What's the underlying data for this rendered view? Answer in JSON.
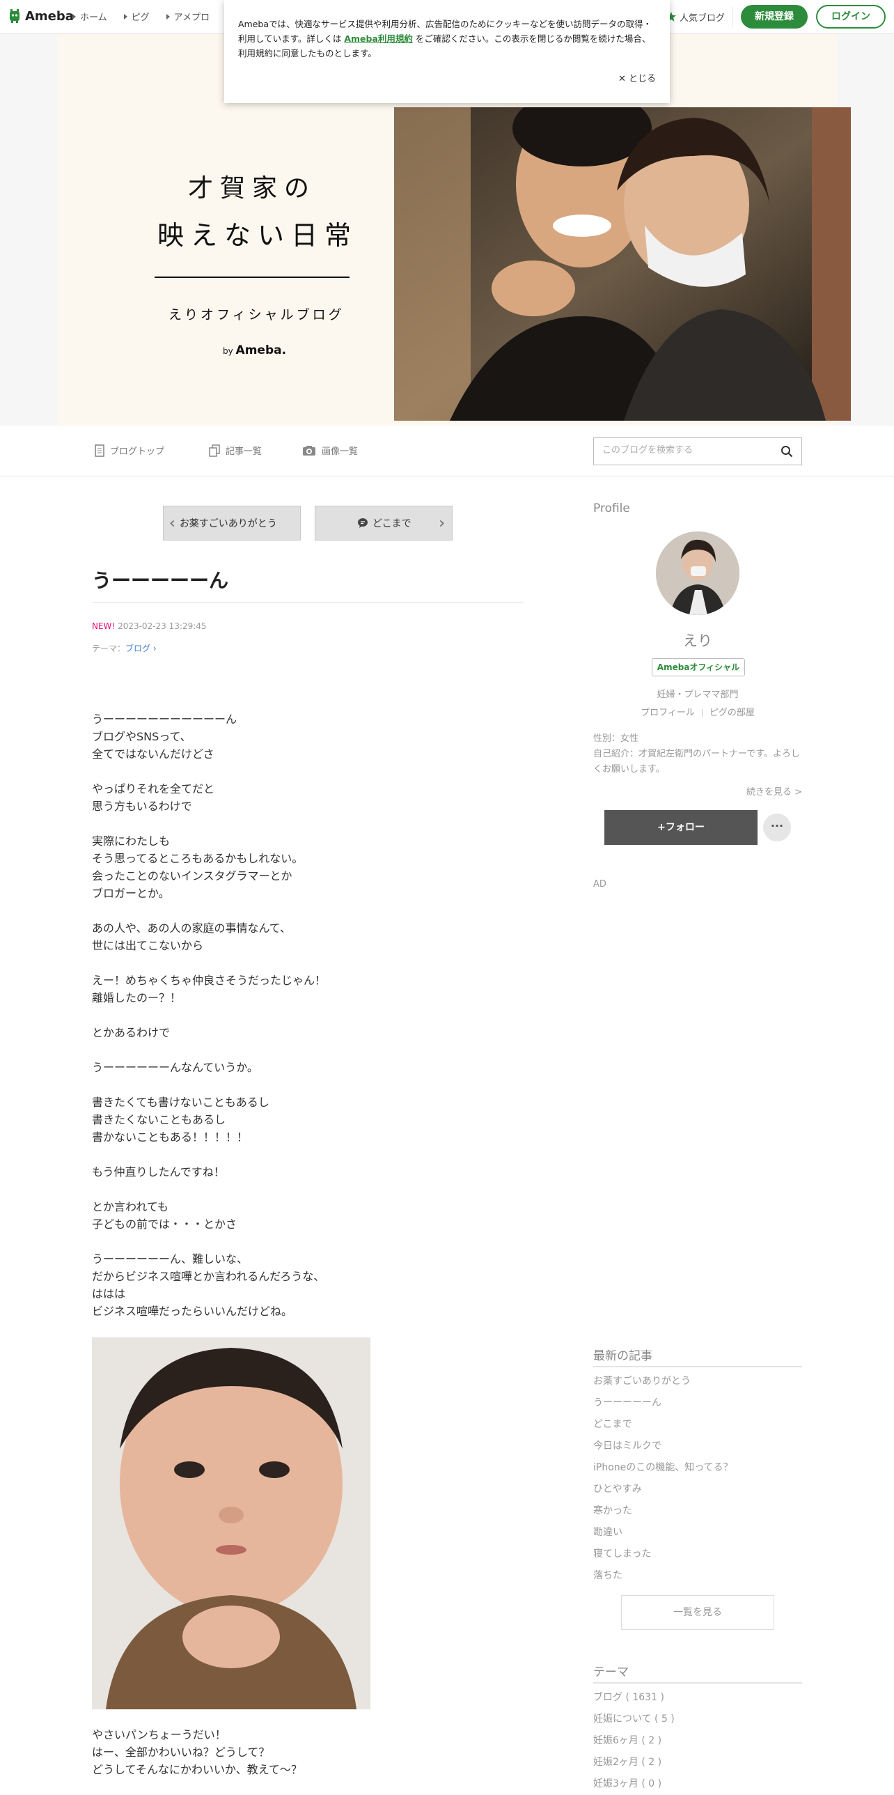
{
  "header": {
    "logo": "Ameba",
    "nav": [
      "ホーム",
      "ピグ",
      "アメプロ"
    ],
    "popular_blog": "人気ブログ",
    "register": "新規登録",
    "login": "ログイン"
  },
  "cookie": {
    "text_before": "Amebaでは、快適なサービス提供や利用分析、広告配信のためにクッキーなどを使い訪問データの取得・利用しています。詳しくは ",
    "link": "Ameba利用規約",
    "text_after": " をご確認ください。この表示を閉じるか閲覧を続けた場合、利用規約に同意したものとします。",
    "close": "とじる"
  },
  "hero": {
    "title_line1": "才賀家の",
    "title_line2": "映えない日常",
    "subtitle": "えりオフィシャルブログ",
    "by": "by",
    "by_brand": "Ameba."
  },
  "blog_nav": {
    "top": "ブログトップ",
    "articles": "記事一覧",
    "images": "画像一覧",
    "search_placeholder": "このブログを検索する"
  },
  "pager": {
    "prev": "お薬すごいありがとう",
    "next": "どこまで"
  },
  "article": {
    "title": "うーーーーーん",
    "new_label": "NEW!",
    "datetime": "2023-02-23 13:29:45",
    "theme_label": "テーマ：",
    "theme": "ブログ",
    "paragraphs": [
      "うーーーーーーーーーーーん\nブログやSNSって、\n全てではないんだけどさ",
      "やっぱりそれを全てだと\n思う方もいるわけで",
      "実際にわたしも\nそう思ってるところもあるかもしれない。\n会ったことのないインスタグラマーとか\nブロガーとか。",
      "あの人や、あの人の家庭の事情なんて、\n世には出てこないから",
      "えー！めちゃくちゃ仲良さそうだったじゃん！\n離婚したのー？！",
      "とかあるわけで",
      "うーーーーーーんなんていうか。",
      "書きたくても書けないこともあるし\n書きたくないこともあるし\n書かないこともある！！！！！",
      "もう仲直りしたんですね！",
      "とか言われても\n子どもの前では・・・とかさ",
      "うーーーーーーん、難しいな、\nだからビジネス喧嘩とか言われるんだろうな、\nははは\nビジネス喧嘩だったらいいんだけどね。"
    ],
    "after_image": [
      "やさいパンちょーうだい！",
      "はー、全部かわいいね？どうして？\nどうしてそんなにかわいいか、教えて〜？"
    ]
  },
  "sidebar": {
    "profile_heading": "Profile",
    "name": "えり",
    "badge": "Amebaオフィシャル",
    "category": "妊婦・プレママ部門",
    "profile_link": "プロフィール",
    "pig_link": "ピグの部屋",
    "gender": "性別：女性",
    "intro": "自己紹介：才賀紀左衛門のパートナーです。よろしくお願いします。",
    "read_more": "続きを見る >",
    "follow": "+フォロー",
    "more": "···",
    "ad": "AD",
    "recent_heading": "最新の記事",
    "recent": [
      "お薬すごいありがとう",
      "うーーーーーん",
      "どこまで",
      "今日はミルクで",
      "iPhoneのこの機能、知ってる？",
      "ひとやすみ",
      "寒かった",
      "勘違い",
      "寝てしまった",
      "落ちた"
    ],
    "see_all": "一覧を見る",
    "theme_heading": "テーマ",
    "themes": [
      "ブログ ( 1631 )",
      "妊娠について ( 5 )",
      "妊娠6ヶ月 ( 2 )",
      "妊娠2ヶ月 ( 2 )",
      "妊娠3ヶ月 ( 0 )"
    ]
  },
  "colors": {
    "brand_green": "#2d8c3c",
    "new_pink": "#e5127d",
    "hero_cream": "#fdf8ef"
  }
}
